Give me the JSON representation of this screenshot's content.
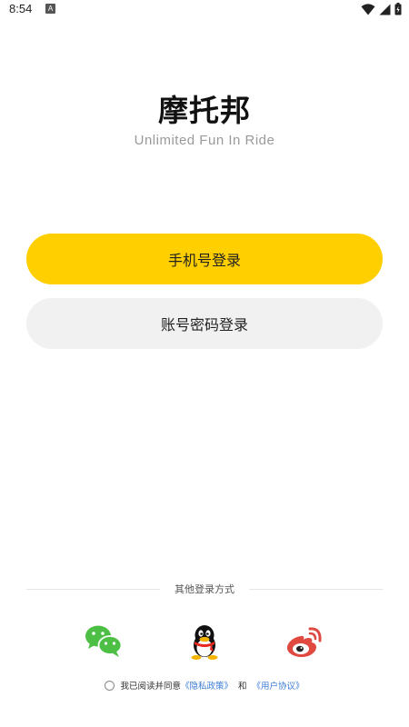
{
  "status_bar": {
    "time": "8:54",
    "notification_badge": "A"
  },
  "brand": {
    "title": "摩托邦",
    "subtitle": "Unlimited Fun In Ride"
  },
  "buttons": {
    "phone_login": "手机号登录",
    "account_login": "账号密码登录"
  },
  "other_login": {
    "label": "其他登录方式",
    "providers": [
      "wechat-icon",
      "qq-icon",
      "weibo-icon"
    ]
  },
  "agreement": {
    "prefix": "我已阅读并同意",
    "privacy_link": "《隐私政策》",
    "and": "和",
    "user_link": "《用户协议》"
  },
  "colors": {
    "primary": "#ffcf00",
    "secondary": "#f1f1f1",
    "link": "#3a7bd5",
    "wechat": "#4cbf44",
    "weibo": "#e0493f"
  }
}
